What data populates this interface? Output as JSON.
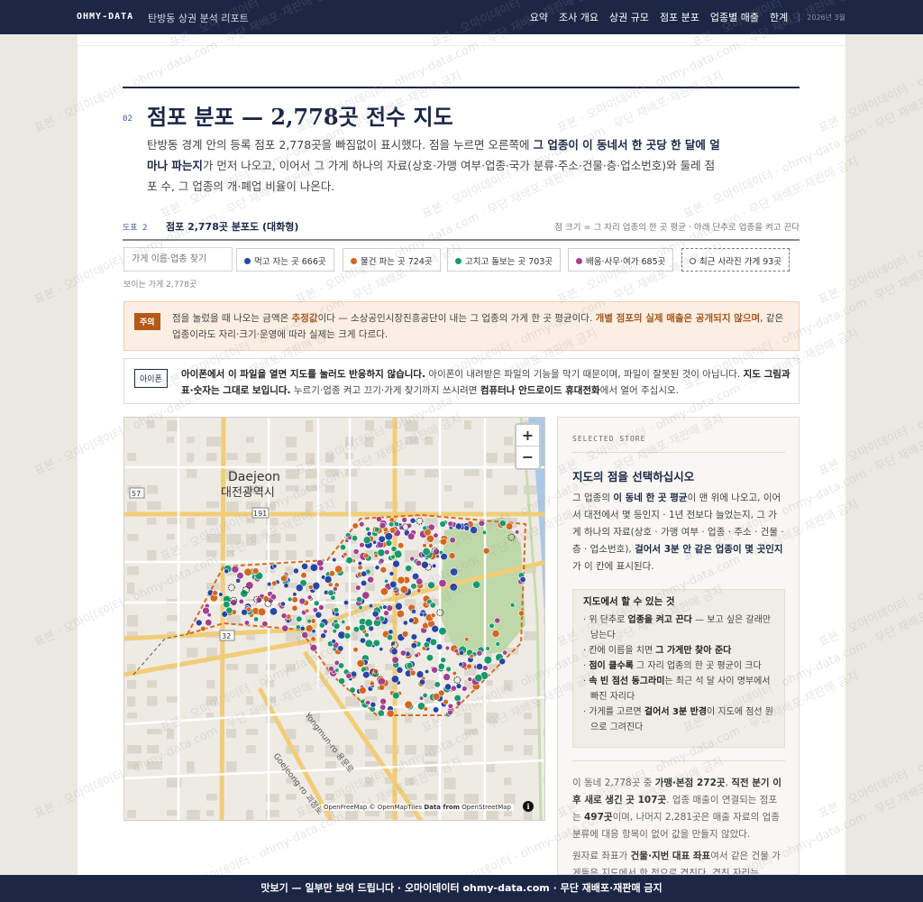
{
  "topbar": {
    "brand": "OHMY-DATA",
    "report_title": "탄방동 상권 분석 리포트",
    "nav": [
      "요약",
      "조사 개요",
      "상권 규모",
      "점포 분포",
      "업종별 매출",
      "한계"
    ],
    "date": "2026년 3월"
  },
  "section": {
    "number": "02",
    "title": "점포 분포 — 2,778곳 전수 지도",
    "lede_1": "탄방동 경계 안의 등록 점포 2,778곳을 빠짐없이 표시했다. 점을 누르면 오른쪽에 ",
    "lede_bold": "그 업종이 이 동네서 한 곳당 한 달에 얼마나 파는지",
    "lede_2": "가 먼저 나오고, 이어서 그 가게 하나의 자료(상호·가맹 여부·업종·국가 분류·주소·건물·층·업소번호)와 둘레 점포 수, 그 업종의 개·폐업 비율이 나온다."
  },
  "figure": {
    "label": "도표 2",
    "title": "점포 2,778곳 분포도 (대화형)",
    "note": "점 크기 = 그 자리 업종의 한 곳 평균 · 아래 단추로 업종을 켜고 끈다"
  },
  "filters": {
    "search_placeholder": "가게 이름·업종 찾기",
    "chips": [
      {
        "label": "먹고 자는 곳 666곳",
        "color": "#2747a6"
      },
      {
        "label": "물건 파는 곳 724곳",
        "color": "#d4671c"
      },
      {
        "label": "고치고 돌보는 곳 703곳",
        "color": "#179a6a"
      },
      {
        "label": "배움·사무·여가 685곳",
        "color": "#a1418f"
      }
    ],
    "closed_chip": "최근 사라진 가게 93곳",
    "visible_count": "보이는 가게 2,778곳"
  },
  "caution": {
    "tag": "주의",
    "t1": "점을 눌렀을 때 나오는 금액은 ",
    "t1_hl": "추정값",
    "t2": "이다 — 소상공인시장진흥공단이 내는 그 업종의 가게 한 곳 평균이다. ",
    "t2_hl": "개별 점포의 실제 매출은 공개되지 않으며",
    "t3": ", 같은 업종이라도 자리·크기·운영에 따라 실제는 크게 다르다."
  },
  "iphone": {
    "tag": "아이폰",
    "b1": "아이폰에서 이 파일을 열면 지도를 눌러도 반응하지 않습니다.",
    "t1": " 아이폰이 내려받은 파일의 기능을 막기 때문이며, 파일이 잘못된 것이 아닙니다. ",
    "b2": "지도 그림과 표·숫자는 그대로 보입니다.",
    "t2": " 누르기·업종 켜고 끄기·가게 찾기까지 쓰시려면 ",
    "b3": "컴퓨터나 안드로이드 휴대전화",
    "t3": "에서 열어 주십시오."
  },
  "map": {
    "city_en": "Daejeon",
    "city_ko": "대전광역시",
    "road_57": "57",
    "road_32": "32",
    "road_191": "191",
    "road_a": "Yongmun-ro 용문로",
    "road_b": "Goejeong-ro 괴정로",
    "attribution_1": "OpenFreeMap © OpenMapTiles ",
    "attribution_bold": "Data from",
    "attribution_2": " OpenStreetMap",
    "zoom_in": "+",
    "zoom_out": "−",
    "info": "i"
  },
  "panel": {
    "kicker": "SELECTED STORE",
    "heading": "지도의 점을 선택하십시오",
    "p1_a": "그 업종의 ",
    "p1_b": "이 동네 한 곳 평균",
    "p1_c": "이 맨 위에 나오고, 이어서 대전에서 몇 등인지 · 1년 전보다 늘었는지, 그 가게 하나의 자료(상호 · 가맹 여부 · 업종 · 주소 · 건물 · 층 · 업소번호), ",
    "p1_d": "걸어서 3분 안 같은 업종이 몇 곳인지",
    "p1_e": "가 이 칸에 표시된다.",
    "howto_title": "지도에서 할 수 있는 것",
    "howto": [
      {
        "pre": "· 위 단추로 ",
        "b": "업종을 켜고 끈다",
        "post": " — 보고 싶은 갈래만 남는다"
      },
      {
        "pre": "· 칸에 이름을 치면 ",
        "b": "그 가게만 찾아 준다",
        "post": ""
      },
      {
        "pre": "· ",
        "b": "점이 클수록",
        "post": " 그 자리 업종의 한 곳 평균이 크다"
      },
      {
        "pre": "· ",
        "b": "속 빈 점선 동그라미",
        "post": "는 최근 석 달 사이 명부에서 빠진 자리다"
      },
      {
        "pre": "· 가게를 고르면 ",
        "b": "걸어서 3분 반경",
        "post": "이 지도에 점선 원으로 그려진다"
      }
    ],
    "p2_a": "이 동네 2,778곳 중 ",
    "p2_b": "가맹·본점 272곳",
    "p2_c": ", ",
    "p2_d": "직전 분기 이후 새로 생긴 곳 107곳",
    "p2_e": ". 업종 매출이 연결되는 점포는 ",
    "p2_f": "497곳",
    "p2_g": "이며, 나머지 2,281곳은 매출 자료의 업종 분류에 대응 항목이 없어 값을 만들지 않았다.",
    "p3_a": "원자료 좌표가 ",
    "p3_b": "건물·지번 대표 좌표",
    "p3_c": "여서 같은 건물 가게들은 지도에서 한 점으로 겹친다. 겹친 자리는"
  },
  "footer": "맛보기 — 일부만 보여 드립니다 · 오마이데이터 ohmy-data.com · 무단 재배포·재판매 금지",
  "watermark": "표본 · 오마이데이터 · ohmy-data.com · 무단 재배포·재판매 금지"
}
